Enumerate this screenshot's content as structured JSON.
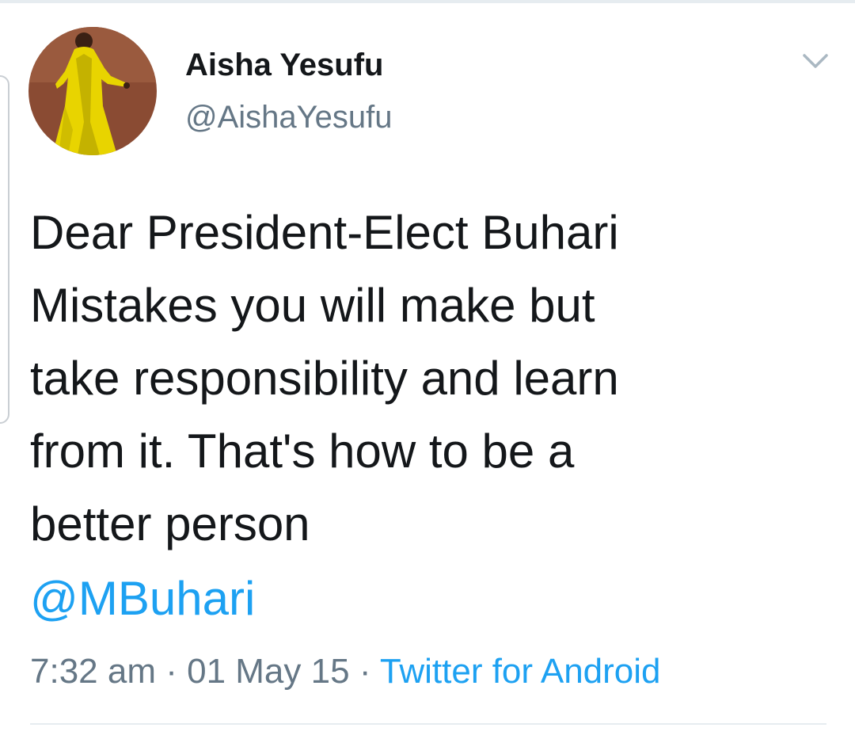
{
  "colors": {
    "text_primary": "#14171a",
    "text_secondary": "#657786",
    "link": "#1da1f2",
    "divider": "#e6ecf0"
  },
  "tweet": {
    "author": {
      "display_name": "Aisha Yesufu",
      "handle": "@AishaYesufu",
      "avatar_icon": "profile-photo"
    },
    "menu_icon": "chevron-down-icon",
    "body_lines": [
      "Dear President-Elect Buhari",
      "Mistakes you will make but",
      "take responsibility and learn",
      "from it. That's how to be a",
      "better person"
    ],
    "mention": "@MBuhari",
    "time": "7:32 am",
    "date": "01 May 15",
    "separator": "·",
    "source": "Twitter for Android"
  }
}
